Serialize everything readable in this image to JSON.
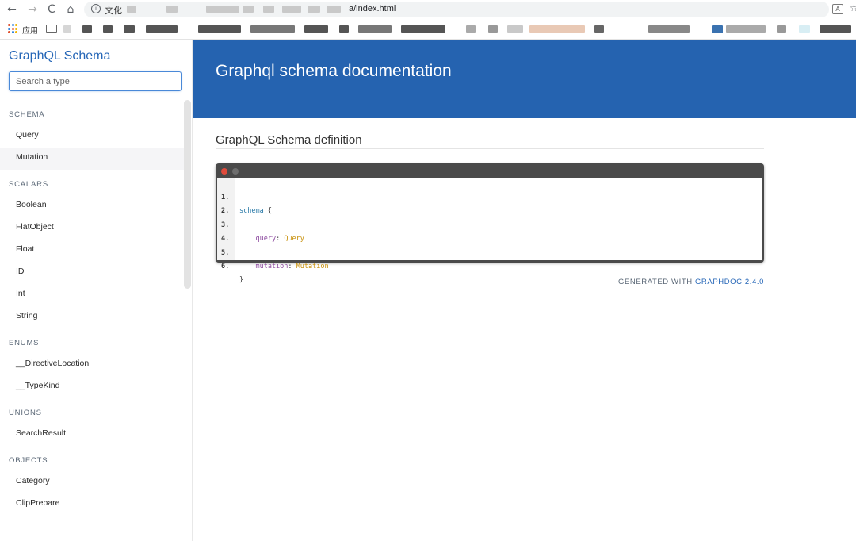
{
  "browser": {
    "nav": {
      "back": "←",
      "forward": "→",
      "reload": "C",
      "home": "⌂"
    },
    "address_label": "文化",
    "url": "a/index.html",
    "bookmarks_apps_label": "应用"
  },
  "sidebar": {
    "title": "GraphQL Schema",
    "search_placeholder": "Search a type",
    "sections": [
      {
        "title": "SCHEMA",
        "items": [
          "Query",
          "Mutation"
        ]
      },
      {
        "title": "SCALARS",
        "items": [
          "Boolean",
          "FlatObject",
          "Float",
          "ID",
          "Int",
          "String"
        ]
      },
      {
        "title": "ENUMS",
        "items": [
          "__DirectiveLocation",
          "__TypeKind"
        ]
      },
      {
        "title": "UNIONS",
        "items": [
          "SearchResult"
        ]
      },
      {
        "title": "OBJECTS",
        "items": [
          "Category",
          "ClipPrepare"
        ]
      }
    ]
  },
  "main": {
    "header_title": "Graphql schema documentation",
    "section_title": "GraphQL Schema definition",
    "code_lines": [
      {
        "num": "1.",
        "keyword": "schema",
        "field": "",
        "type": "",
        "text": " {"
      },
      {
        "num": "2.",
        "keyword": "",
        "field": "",
        "type": "",
        "text": ""
      },
      {
        "num": "3.",
        "keyword": "",
        "field": "    query",
        "type": "Query",
        "text": ": "
      },
      {
        "num": "4.",
        "keyword": "",
        "field": "",
        "type": "",
        "text": ""
      },
      {
        "num": "5.",
        "keyword": "",
        "field": "    mutation",
        "type": "Mutation",
        "text": ": "
      },
      {
        "num": "6.",
        "keyword": "",
        "field": "",
        "type": "",
        "text": "}"
      }
    ],
    "footer_prefix": "GENERATED WITH",
    "footer_link": "GRAPHDOC 2.4.0"
  }
}
